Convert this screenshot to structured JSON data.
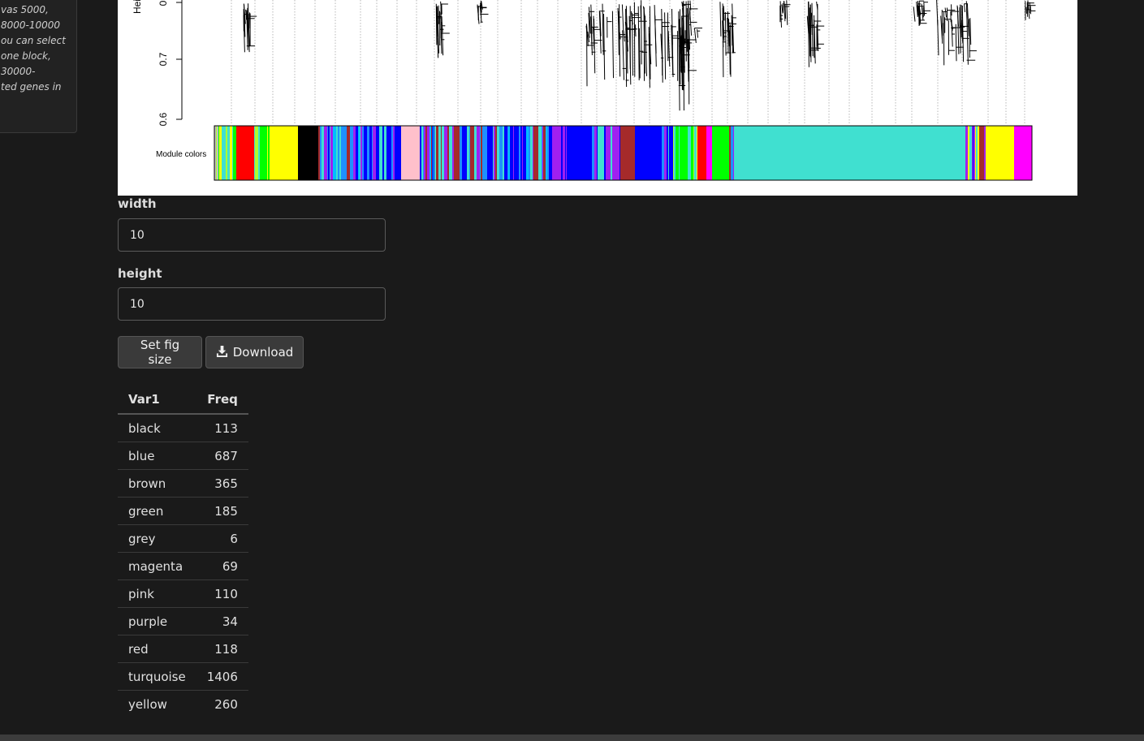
{
  "sidebar": {
    "lines": [
      "vas 5000,",
      "8000-10000",
      "ou can select",
      "one block,",
      "30000-",
      "ted genes in"
    ]
  },
  "plot": {
    "y_axis_label": "Hei",
    "y_ticks": [
      "0.6",
      "0.7",
      "0"
    ],
    "module_label": "Module colors",
    "module_colors": {
      "black": "#000000",
      "blue": "#0000ff",
      "brown": "#a52a2a",
      "green": "#00ff00",
      "grey": "#bebebe",
      "magenta": "#ff00ff",
      "pink": "#ffc0cb",
      "purple": "#a020f0",
      "red": "#ff0000",
      "turquoise": "#40e0d0",
      "yellow": "#ffff00",
      "lightblue": "#1e90ff",
      "skyblue": "#00bfff",
      "greenyellow": "#adff2f"
    }
  },
  "form": {
    "width_label": "width",
    "width_value": "10",
    "height_label": "height",
    "height_value": "10",
    "set_fig_size_label": "Set fig size",
    "download_label": "Download",
    "download_icon": "download-icon"
  },
  "table": {
    "headers": [
      "Var1",
      "Freq"
    ],
    "rows": [
      {
        "Var1": "black",
        "Freq": "113"
      },
      {
        "Var1": "blue",
        "Freq": "687"
      },
      {
        "Var1": "brown",
        "Freq": "365"
      },
      {
        "Var1": "green",
        "Freq": "185"
      },
      {
        "Var1": "grey",
        "Freq": "6"
      },
      {
        "Var1": "magenta",
        "Freq": "69"
      },
      {
        "Var1": "pink",
        "Freq": "110"
      },
      {
        "Var1": "purple",
        "Freq": "34"
      },
      {
        "Var1": "red",
        "Freq": "118"
      },
      {
        "Var1": "turquoise",
        "Freq": "1406"
      },
      {
        "Var1": "yellow",
        "Freq": "260"
      }
    ]
  }
}
